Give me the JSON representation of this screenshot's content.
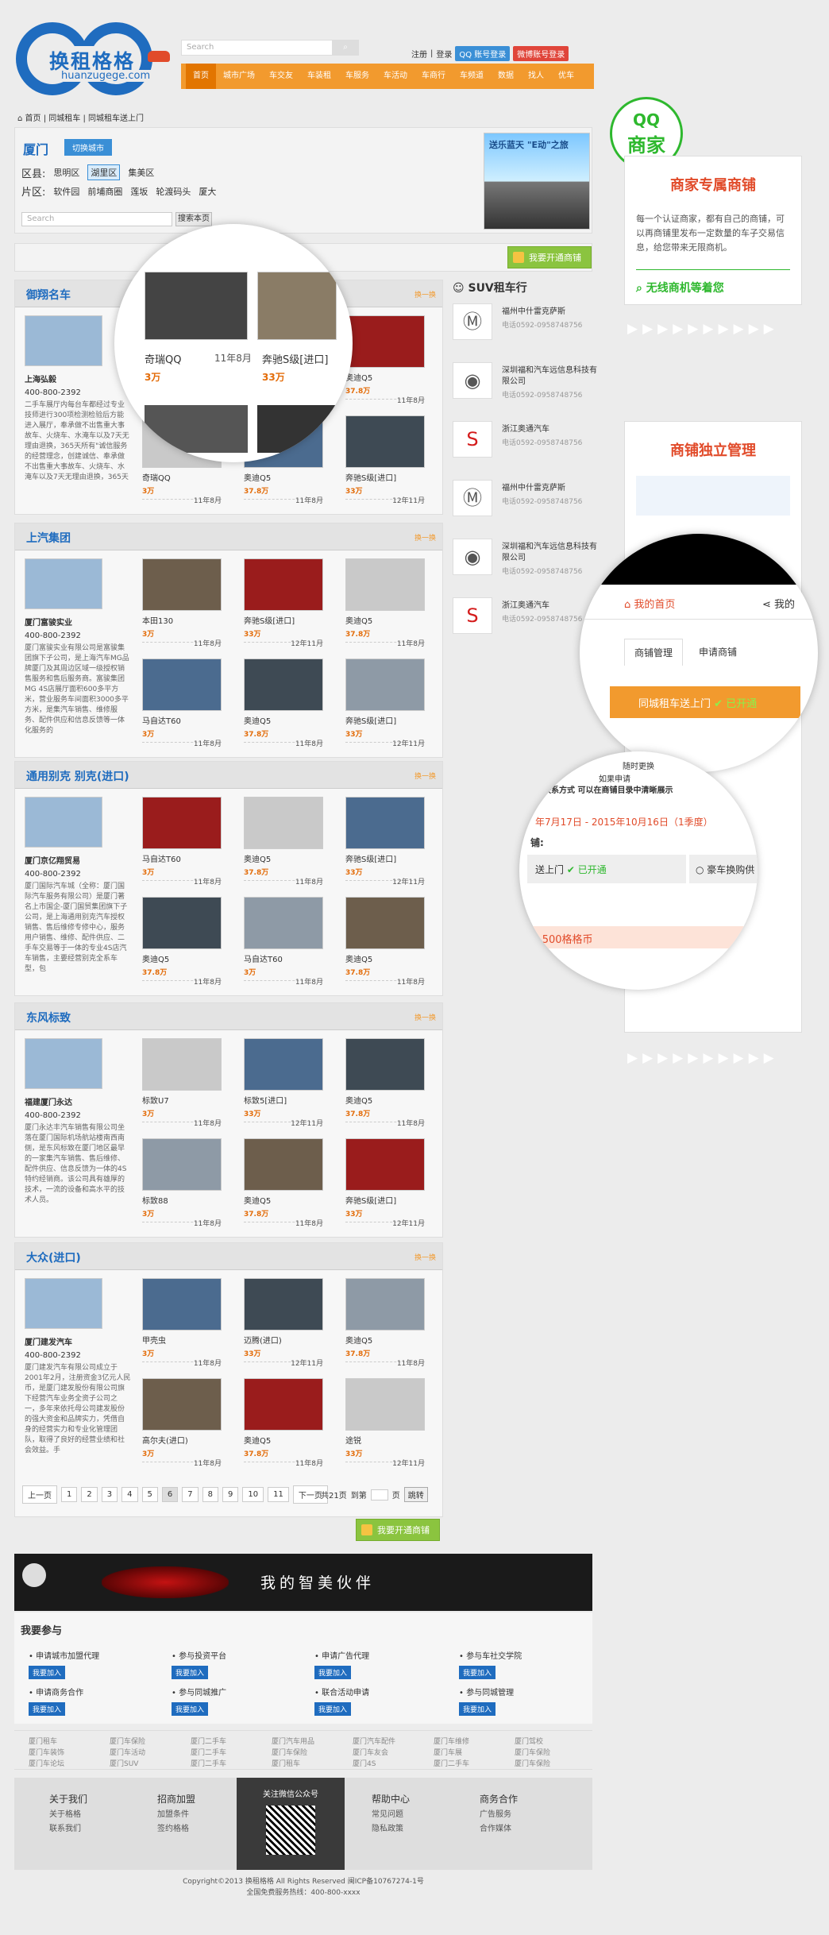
{
  "header": {
    "logo_cn": "换租格格",
    "logo_en": "huanzugege.com",
    "search_placeholder": "Search",
    "links": [
      "注册",
      "登录"
    ],
    "qq_login": "QQ 账号登录",
    "weibo_login": "微博账号登录",
    "nav": [
      "首页",
      "城市广场",
      "车交友",
      "车装租",
      "车服务",
      "车活动",
      "车商行",
      "车频道",
      "数据",
      "找人",
      "优车"
    ]
  },
  "breadcrumb": [
    "首页",
    "同城租车",
    "同城租车送上门"
  ],
  "city": {
    "name": "厦门",
    "switch": "切换城市",
    "district_label": "区县:",
    "districts": [
      "思明区",
      "湖里区",
      "集美区"
    ],
    "area_label": "片区:",
    "areas": [
      "软件园",
      "前埔商圈",
      "莲坂",
      "轮渡码头",
      "厦大"
    ],
    "search_placeholder": "Search",
    "search_btn": "搜索本页",
    "ad_text": "送乐蓝天 \"E动\"之旅"
  },
  "open_shop": "我要开通商铺",
  "more": "换一换",
  "sections": [
    {
      "title": "御翔名车",
      "dealer": "上海弘毅",
      "tel": "400-800-2392",
      "desc": "二手车展厅内每台车都经过专业技师进行300项检测检验后方能进入展厅，奉承做不出售重大事故车、火烧车、水淹车以及7天无理由退换，365天所有\"诚信服务的经营理念，创建诚信、奉承做不出售重大事故车、火烧车、水淹车以及7天无理由退换，365天",
      "cars": [
        [
          "奇瑞QQ",
          "3万",
          "11年8月"
        ],
        [
          "奔驰S级[进口]",
          "33万",
          "11年8月"
        ],
        [
          "奥迪Q5",
          "37.8万",
          "11年8月"
        ],
        [
          "奇瑞QQ",
          "3万",
          "11年8月"
        ],
        [
          "奥迪Q5",
          "37.8万",
          "11年8月"
        ],
        [
          "奔驰S级[进口]",
          "33万",
          "12年11月"
        ]
      ]
    },
    {
      "title": "上汽集团",
      "dealer": "厦门富骏实业",
      "tel": "400-800-2392",
      "desc": "厦门富骏实业有限公司是富骏集团旗下子公司，是上海汽车MG品牌厦门及其周边区域一级授权销售服务和售后服务商。富骏集团MG 4S店展厅面积600多平方米，营业服务车间面积3000多平方米，是集汽车销售、维修服务、配件供应和信息反馈等一体化服务的",
      "cars": [
        [
          "本田130",
          "3万",
          "11年8月"
        ],
        [
          "奔驰S级[进口]",
          "33万",
          "12年11月"
        ],
        [
          "奥迪Q5",
          "37.8万",
          "11年8月"
        ],
        [
          "马自达T60",
          "3万",
          "11年8月"
        ],
        [
          "奥迪Q5",
          "37.8万",
          "11年8月"
        ],
        [
          "奔驰S级[进口]",
          "33万",
          "12年11月"
        ]
      ]
    },
    {
      "title": "通用别克 别克(进口)",
      "dealer": "厦门京亿翔贸易",
      "tel": "400-800-2392",
      "desc": "厦门国际汽车城（全称：厦门国际汽车服务有限公司）是厦门著名上市国企-厦门国贸集团旗下子公司，是上海通用别克汽车授权销售、售后维修专修中心，服务用户销售、维修、配件供应、二手车交易等于一体的专业4S店汽车销售，主要经营别克全系车型，包",
      "cars": [
        [
          "马自达T60",
          "3万",
          "11年8月"
        ],
        [
          "奥迪Q5",
          "37.8万",
          "11年8月"
        ],
        [
          "奔驰S级[进口]",
          "33万",
          "12年11月"
        ],
        [
          "奥迪Q5",
          "37.8万",
          "11年8月"
        ],
        [
          "马自达T60",
          "3万",
          "11年8月"
        ],
        [
          "奥迪Q5",
          "37.8万",
          "11年8月"
        ]
      ]
    },
    {
      "title": "东风标致",
      "dealer": "福建厦门永达",
      "tel": "400-800-2392",
      "desc": "厦门永达丰汽车销售有限公司坐落在厦门国际机场航站楼南西南侧，是东风标致在厦门地区最早的一家集汽车销售、售后维修、配件供应、信息反馈为一体的4S特约经销商。该公司具有雄厚的技术，一流的设备和高水平的技术人员。",
      "cars": [
        [
          "标致U7",
          "3万",
          "11年8月"
        ],
        [
          "标致5[进口]",
          "33万",
          "12年11月"
        ],
        [
          "奥迪Q5",
          "37.8万",
          "11年8月"
        ],
        [
          "标致88",
          "3万",
          "11年8月"
        ],
        [
          "奥迪Q5",
          "37.8万",
          "11年8月"
        ],
        [
          "奔驰S级[进口]",
          "33万",
          "12年11月"
        ]
      ]
    },
    {
      "title": "大众(进口)",
      "dealer": "厦门建发汽车",
      "tel": "400-800-2392",
      "desc": "厦门建发汽车有限公司成立于2001年2月，注册资金3亿元人民币，是厦门建发股份有限公司旗下经营汽车业务全资子公司之一，多年来依托母公司建发股份的强大资金和品牌实力，凭借自身的经营实力和专业化管理团队，取得了良好的经营业绩和社会效益。手",
      "cars": [
        [
          "甲壳虫",
          "3万",
          "11年8月"
        ],
        [
          "迈腾(进口)",
          "33万",
          "12年11月"
        ],
        [
          "奥迪Q5",
          "37.8万",
          "11年8月"
        ],
        [
          "高尔夫(进口)",
          "3万",
          "11年8月"
        ],
        [
          "奥迪Q5",
          "37.8万",
          "11年8月"
        ],
        [
          "途锐",
          "33万",
          "12年11月"
        ]
      ]
    }
  ],
  "suv": {
    "title": "SUV租车行",
    "items": [
      [
        "福州中什雷克萨斯",
        "电话0592-0958748756"
      ],
      [
        "深圳福和汽车远信息科技有限公司",
        "电话0592-0958748756"
      ],
      [
        "浙江奥通汽车",
        "电话0592-0958748756"
      ],
      [
        "福州中什雷克萨斯",
        "电话0592-0958748756"
      ],
      [
        "深圳福和汽车远信息科技有限公司",
        "电话0592-0958748756"
      ],
      [
        "浙江奥通汽车",
        "电话0592-0958748756"
      ]
    ]
  },
  "pager": {
    "prev": "上一页",
    "pages": [
      "1",
      "2",
      "3",
      "4",
      "5",
      "6",
      "7",
      "8",
      "9",
      "10",
      "11"
    ],
    "next": "下一页",
    "total": "共21页",
    "goto": "到第",
    "page": "页",
    "go": "跳转"
  },
  "banner": "我的智美伙伴",
  "join": {
    "title": "我要参与",
    "items": [
      "申请城市加盟代理",
      "参与投资平台",
      "申请广告代理",
      "参与车社交学院",
      "申请商务合作",
      "参与同城推广",
      "联合活动申请",
      "参与同城管理"
    ],
    "btn": "我要加入"
  },
  "links": [
    "厦门租车",
    "厦门车保险",
    "厦门二手车",
    "厦门汽车用品",
    "厦门汽车配件",
    "厦门车维修",
    "厦门驾校",
    "厦门车装饰",
    "厦门车活动",
    "厦门二手车",
    "厦门车保险",
    "厦门车友会",
    "厦门车展",
    "厦门车保险",
    "厦门车论坛",
    "厦门SUV",
    "厦门二手车",
    "厦门租车",
    "厦门4S",
    "厦门二手车",
    "厦门车保险"
  ],
  "footer": {
    "cols": [
      [
        "关于我们",
        "关于格格",
        "联系我们"
      ],
      [
        "招商加盟",
        "加盟条件",
        "签约格格"
      ],
      [
        "帮助中心",
        "常见问题",
        "隐私政策"
      ],
      [
        "商务合作",
        "广告服务",
        "合作媒体"
      ]
    ],
    "qr": "关注微信公众号"
  },
  "copyright": [
    "Copyright©2013 换租格格 All Rights Reserved 闽ICP备10767274-1号",
    "全国免费服务热线：400-800-xxxx"
  ],
  "magnifier1": {
    "cars": [
      [
        "奇瑞QQ",
        "3万",
        "11年8月"
      ],
      [
        "奔驰S级[进口]",
        "33万",
        ""
      ]
    ]
  },
  "right": {
    "stamp_top": "QQ",
    "stamp_bottom": "商家",
    "panel1_title": "商家专属商铺",
    "panel1_desc": "每一个认证商家，都有自己的商铺，可以再商铺里发布一定数量的车子交易信息，给您带来无限商机。",
    "panel1_link": "无线商机等着您",
    "panel2_title": "商铺独立管理",
    "mag2": {
      "home": "我的首页",
      "share": "我的",
      "tab1": "商铺管理",
      "tab2": "申请商铺",
      "bar": "同城租车送上门",
      "status": "已开通"
    },
    "mag3": {
      "line1": "随时更换",
      "line2": "如果申请",
      "line3": "和联系方式 可以在商铺目录中清晰展示",
      "date": "年7月17日 - 2015年10月16日（1季度）",
      "label": "铺:",
      "opt1": "送上门",
      "st": "已开通",
      "opt2": "豪车换购供",
      "price": "-500格格币"
    }
  }
}
